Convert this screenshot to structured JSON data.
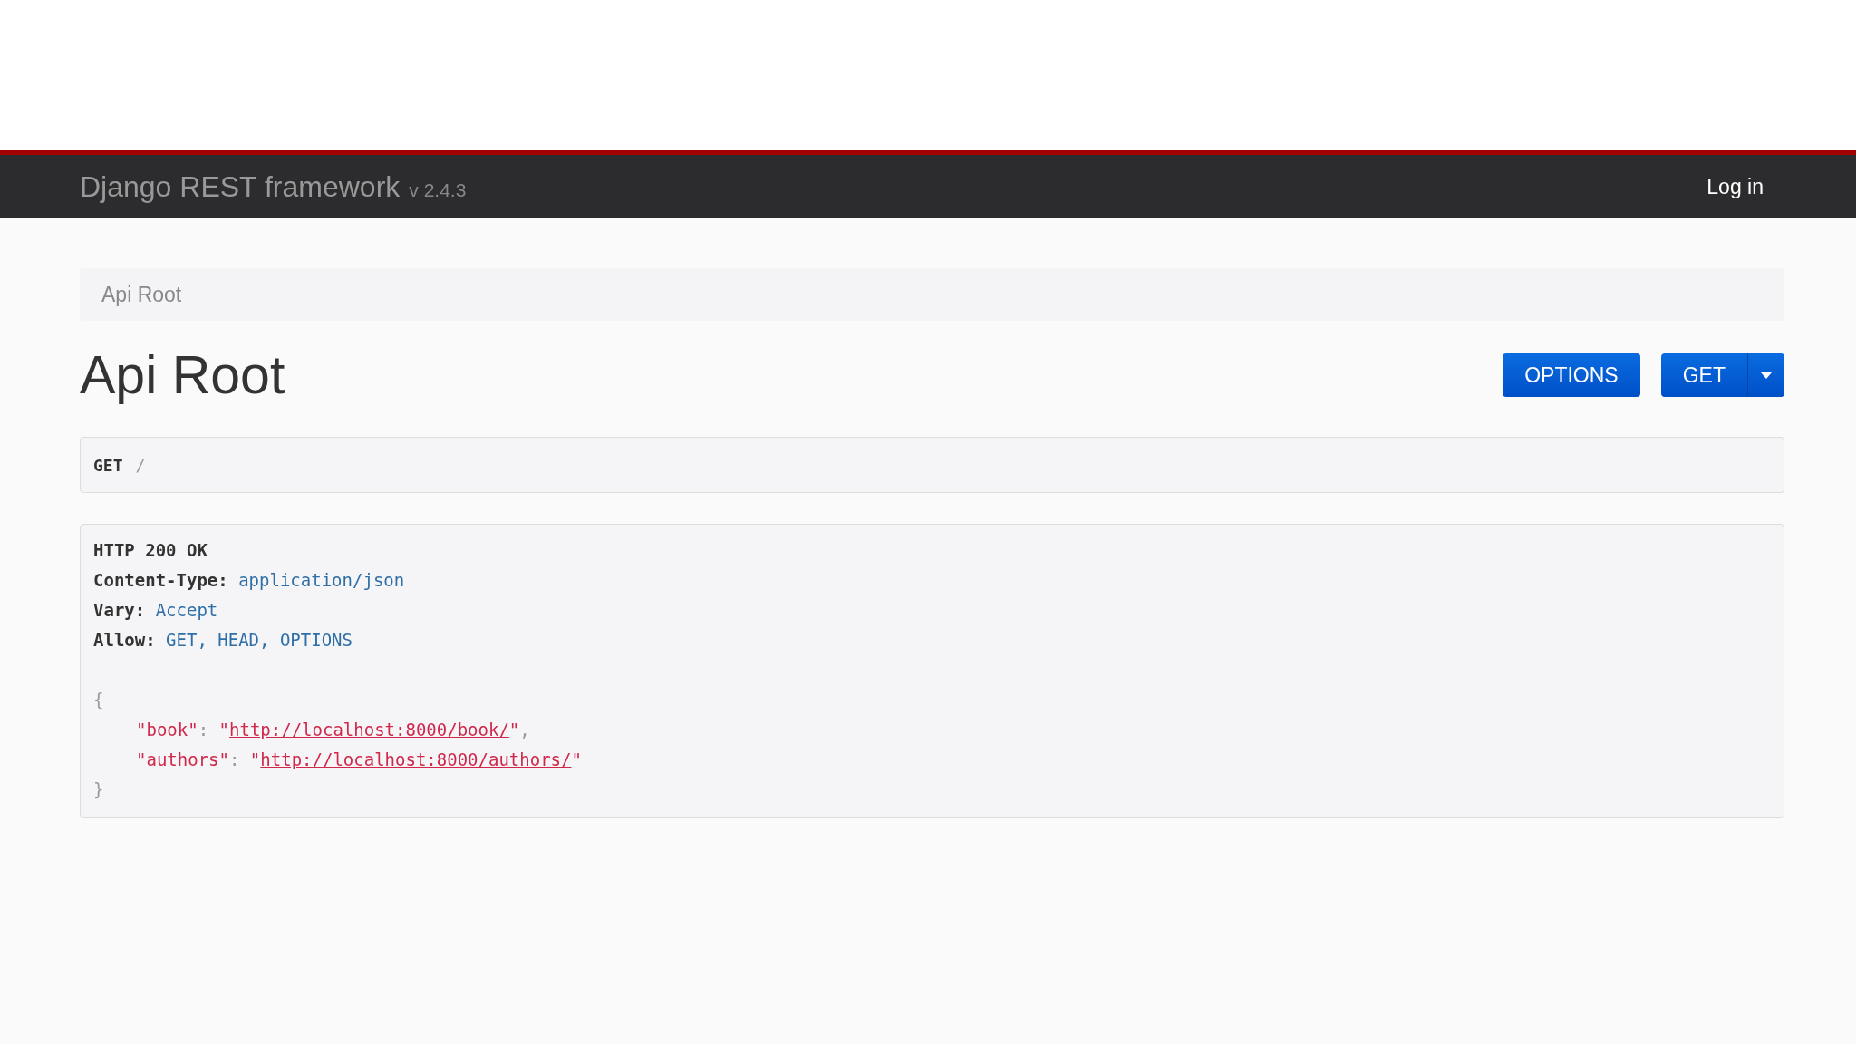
{
  "navbar": {
    "brand": "Django REST framework",
    "version": "v 2.4.3",
    "login": "Log in"
  },
  "breadcrumb": [
    {
      "label": "Api Root",
      "selected": true
    }
  ],
  "title": "Api Root",
  "buttons": {
    "options": "OPTIONS",
    "get": "GET"
  },
  "request": {
    "method": "GET",
    "path": "/"
  },
  "response": {
    "status": "HTTP 200 OK",
    "headers": [
      {
        "name": "Content-Type:",
        "value": "application/json"
      },
      {
        "name": "Vary:",
        "value": "Accept"
      },
      {
        "name": "Allow:",
        "value": "GET, HEAD, OPTIONS"
      }
    ],
    "open": "{",
    "entries": [
      {
        "key": "\"book\"",
        "colon": ":",
        "before": "\"",
        "url": "http://localhost:8000/book/",
        "after": "\"",
        "comma": ","
      },
      {
        "key": "\"authors\"",
        "colon": ":",
        "before": "\"",
        "url": "http://localhost:8000/authors/",
        "after": "\""
      }
    ],
    "close": "}"
  }
}
